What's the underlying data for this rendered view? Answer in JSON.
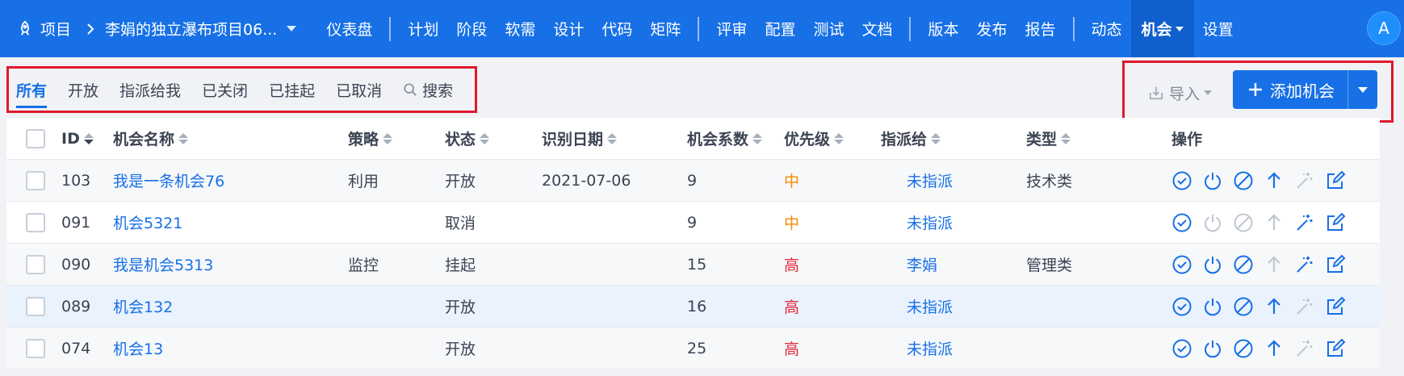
{
  "topbar": {
    "project_label": "项目",
    "project_title": "李娟的独立瀑布项目06...",
    "nav": [
      {
        "label": "仪表盘"
      },
      {
        "label": "计划"
      },
      {
        "label": "阶段"
      },
      {
        "label": "软需"
      },
      {
        "label": "设计"
      },
      {
        "label": "代码"
      },
      {
        "label": "矩阵"
      },
      {
        "label": "评审"
      },
      {
        "label": "配置"
      },
      {
        "label": "测试"
      },
      {
        "label": "文档"
      },
      {
        "label": "版本"
      },
      {
        "label": "发布"
      },
      {
        "label": "报告"
      },
      {
        "label": "动态"
      },
      {
        "label": "机会"
      },
      {
        "label": "设置"
      }
    ],
    "avatar": "A"
  },
  "tabs": {
    "all": "所有",
    "open": "开放",
    "assigned": "指派给我",
    "closed": "已关闭",
    "suspended": "已挂起",
    "cancelled": "已取消",
    "search": "搜索"
  },
  "actions": {
    "import_label": "导入",
    "add_label": "添加机会"
  },
  "table": {
    "headers": {
      "id": "ID",
      "name": "机会名称",
      "strategy": "策略",
      "status": "状态",
      "date": "识别日期",
      "coef": "机会系数",
      "priority": "优先级",
      "assignee": "指派给",
      "type": "类型",
      "ops": "操作"
    },
    "rows": [
      {
        "id": "103",
        "name": "我是一条机会76",
        "strategy": "利用",
        "status": "开放",
        "date": "2021-07-06",
        "coef": "9",
        "priority": "中",
        "assignee": "未指派",
        "type": "技术类"
      },
      {
        "id": "091",
        "name": "机会5321",
        "strategy": "",
        "status": "取消",
        "date": "",
        "coef": "9",
        "priority": "中",
        "assignee": "未指派",
        "type": ""
      },
      {
        "id": "090",
        "name": "我是机会5313",
        "strategy": "监控",
        "status": "挂起",
        "date": "",
        "coef": "15",
        "priority": "高",
        "assignee": "李娟",
        "type": "管理类"
      },
      {
        "id": "089",
        "name": "机会132",
        "strategy": "",
        "status": "开放",
        "date": "",
        "coef": "16",
        "priority": "高",
        "assignee": "未指派",
        "type": ""
      },
      {
        "id": "074",
        "name": "机会13",
        "strategy": "",
        "status": "开放",
        "date": "",
        "coef": "25",
        "priority": "高",
        "assignee": "未指派",
        "type": ""
      }
    ]
  },
  "colors": {
    "primary": "#1770e6",
    "mid": "#f38b00",
    "high": "#e32938",
    "annotation": "#e0182c"
  }
}
